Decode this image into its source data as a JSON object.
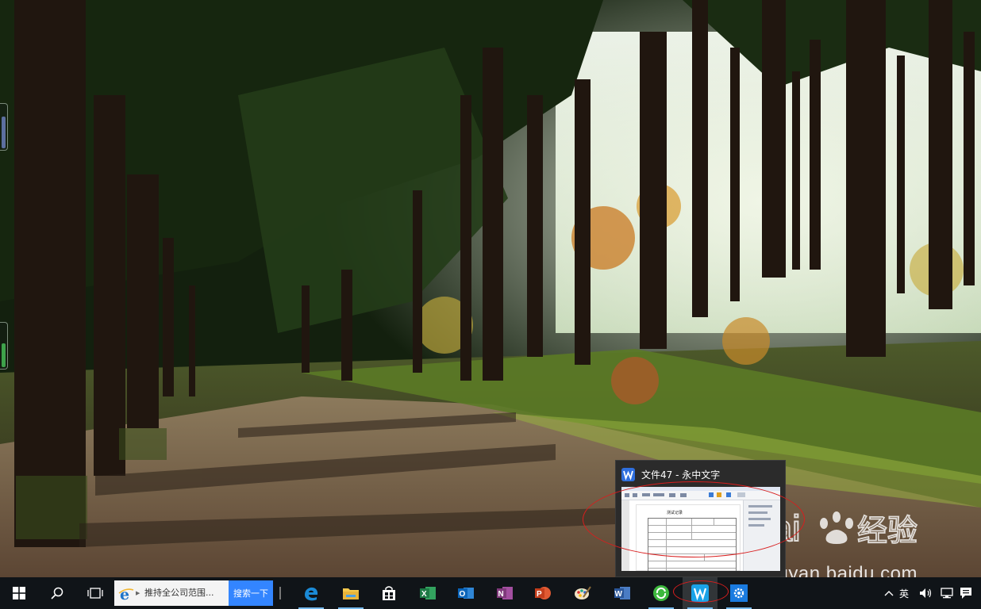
{
  "wallpaper": {
    "description_colors": {
      "sky": "#dfe9df",
      "canopy": "#15230f",
      "path": "#6b5440",
      "moss": "#4a6a22"
    }
  },
  "thumbnail_popup": {
    "title": "文件47 - 永中文字",
    "preview": {
      "document_heading": "测试记录"
    }
  },
  "watermark": {
    "logo": "Baidu经验",
    "url": "jingyan.baidu.com"
  },
  "taskbar": {
    "search": {
      "value": "推持全公司范围...",
      "button_label": "搜索一下"
    },
    "pinned_apps": [
      {
        "name": "Microsoft Edge",
        "icon": "edge-icon"
      },
      {
        "name": "File Explorer",
        "icon": "folder-icon"
      },
      {
        "name": "Microsoft Store",
        "icon": "store-icon"
      },
      {
        "name": "Excel",
        "icon": "excel-icon",
        "letter": "X",
        "color": "#1d7a45"
      },
      {
        "name": "Outlook",
        "icon": "outlook-icon",
        "letter": "O",
        "color": "#0a64b8"
      },
      {
        "name": "OneNote",
        "icon": "onenote-icon",
        "letter": "N",
        "color": "#80397b"
      },
      {
        "name": "PowerPoint",
        "icon": "powerpoint-icon",
        "letter": "P",
        "color": "#c43e1c"
      },
      {
        "name": "Paint",
        "icon": "paint-icon"
      },
      {
        "name": "Word",
        "icon": "word-icon",
        "letter": "W",
        "color": "#2b579a"
      },
      {
        "name": "Green app",
        "icon": "green-circle-icon"
      },
      {
        "name": "永中文字",
        "icon": "yozo-writer-icon",
        "letter": "W",
        "color": "#1aa3e8"
      },
      {
        "name": "Settings",
        "icon": "settings-gear-icon"
      }
    ],
    "tray": {
      "ime_label": "英",
      "icons": [
        "chevron-up-icon",
        "ime-icon",
        "volume-icon",
        "network-icon",
        "notification-icon"
      ]
    }
  },
  "colors": {
    "taskbar_bg": "#101418",
    "accent": "#76b9ed",
    "annotation_red": "#d81e1e",
    "search_blue": "#3385ff"
  }
}
